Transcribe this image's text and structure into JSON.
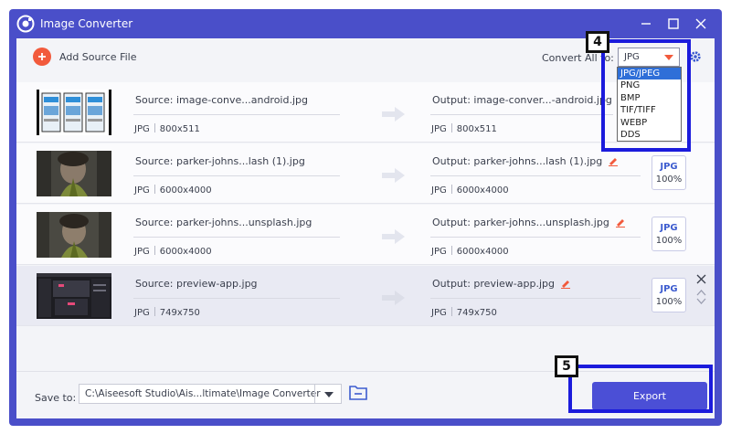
{
  "window": {
    "title": "Image Converter"
  },
  "toolbar": {
    "add_source_label": "Add Source File",
    "convert_all_label": "Convert All to:",
    "convert_all_value": "JPG",
    "format_options": [
      "JPG/JPEG",
      "PNG",
      "BMP",
      "TIF/TIFF",
      "WEBP",
      "DDS"
    ],
    "selected_option": "JPG/JPEG"
  },
  "files": [
    {
      "source": "Source: image-conve...android.jpg",
      "src_format": "JPG",
      "src_size": "800x511",
      "output": "Output: image-conver...-android.jpg",
      "out_format": "JPG",
      "out_size": "800x511",
      "badge_format": "JPG",
      "badge_quality": "100%"
    },
    {
      "source": "Source: parker-johns...lash (1).jpg",
      "src_format": "JPG",
      "src_size": "6000x4000",
      "output": "Output: parker-johns...lash (1).jpg",
      "out_format": "JPG",
      "out_size": "6000x4000",
      "badge_format": "JPG",
      "badge_quality": "100%"
    },
    {
      "source": "Source: parker-johns...unsplash.jpg",
      "src_format": "JPG",
      "src_size": "6000x4000",
      "output": "Output: parker-johns...unsplash.jpg",
      "out_format": "JPG",
      "out_size": "6000x4000",
      "badge_format": "JPG",
      "badge_quality": "100%"
    },
    {
      "source": "Source: preview-app.jpg",
      "src_format": "JPG",
      "src_size": "749x750",
      "output": "Output: preview-app.jpg",
      "out_format": "JPG",
      "out_size": "749x750",
      "badge_format": "JPG",
      "badge_quality": "100%"
    }
  ],
  "footer": {
    "save_to_label": "Save to:",
    "save_path": "C:\\Aiseesoft Studio\\Ais...ltimate\\Image Converter",
    "export_label": "Export"
  },
  "callouts": {
    "dropdown_step": "4",
    "export_step": "5"
  },
  "colors": {
    "window_frame": "#4a4fc9",
    "accent_orange": "#f25a3c",
    "export_button": "#4b4fd6",
    "callout_border": "#1b1bdc",
    "format_blue": "#3d5ccf"
  }
}
